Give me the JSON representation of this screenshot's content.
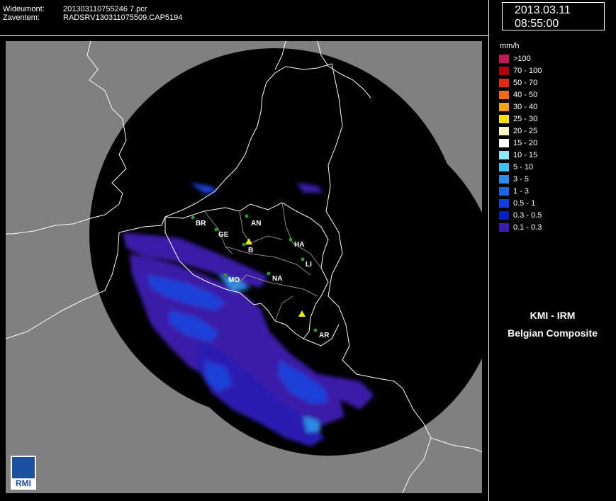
{
  "header": {
    "line1_label": "Wideumont:",
    "line1_value": "201303110755246 7.pcr",
    "line2_label": "Zaventem:",
    "line2_value": "RADSRV130311075509.CAP5194"
  },
  "datetime": {
    "date": "2013.03.11",
    "time": "08:55:00"
  },
  "legend": {
    "unit": "mm/h",
    "items": [
      {
        "label": ">100",
        "color": "#c0185a"
      },
      {
        "label": "70 - 100",
        "color": "#b00010"
      },
      {
        "label": "50 - 70",
        "color": "#e02c0c"
      },
      {
        "label": "40 - 50",
        "color": "#f06a14"
      },
      {
        "label": "30 - 40",
        "color": "#f8a010"
      },
      {
        "label": "25 - 30",
        "color": "#f8e000"
      },
      {
        "label": "20 - 25",
        "color": "#fff6c8"
      },
      {
        "label": "15 - 20",
        "color": "#ffffff"
      },
      {
        "label": "10 - 15",
        "color": "#8ee8f4"
      },
      {
        "label": "5 - 10",
        "color": "#40c0f0"
      },
      {
        "label": "3 - 5",
        "color": "#2c8ce8"
      },
      {
        "label": "1 - 3",
        "color": "#1c64e4"
      },
      {
        "label": "0.5 - 1",
        "color": "#1040e0"
      },
      {
        "label": "0.3 - 0.5",
        "color": "#0a1cc8"
      },
      {
        "label": "0.1 - 0.3",
        "color": "#3a1ea8"
      }
    ]
  },
  "organization": {
    "line1": "KMI - IRM",
    "line2": "Belgian Composite"
  },
  "logo_text": "RMI",
  "map": {
    "city_labels": [
      "BR",
      "GE",
      "AN",
      "B",
      "HA",
      "LI",
      "MO",
      "NA",
      "AR"
    ],
    "colors": {
      "background": "#808080",
      "radar_coverage": "#000000",
      "borders": "#ffffff",
      "city_dot": "#2e9a2e",
      "radar_site": "#f0f000"
    }
  }
}
